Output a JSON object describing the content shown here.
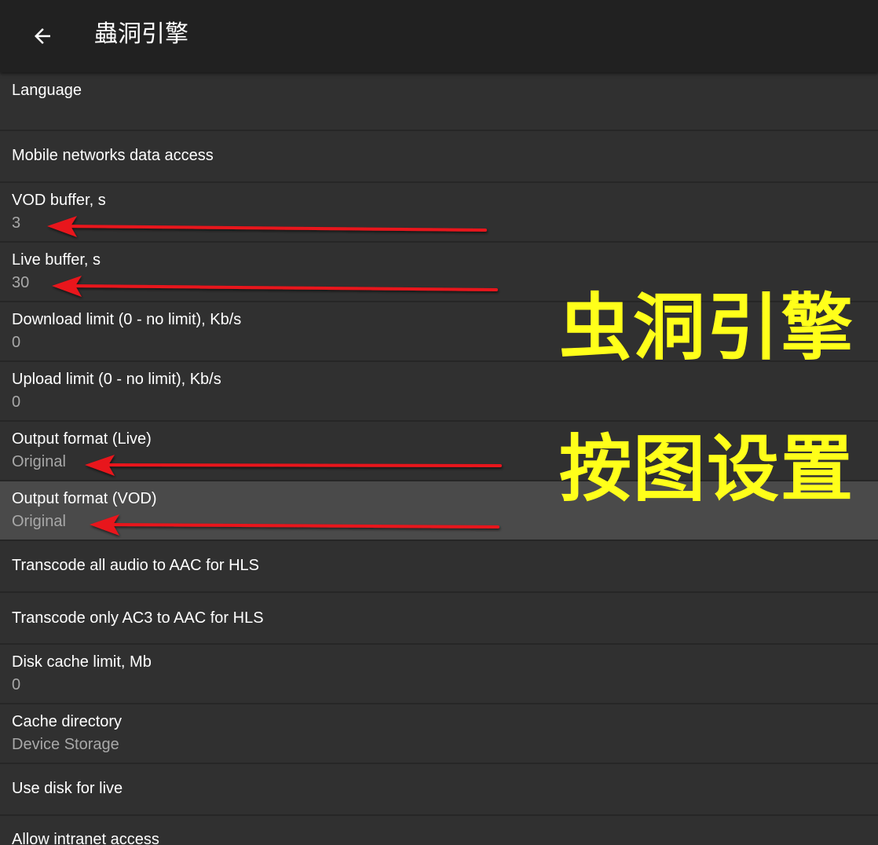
{
  "app_bar": {
    "title": "蟲洞引擎",
    "back_icon": "arrow-back-icon"
  },
  "settings": [
    {
      "id": "language",
      "title": "Language",
      "summary": ""
    },
    {
      "id": "mobile-data",
      "title": "Mobile networks data access",
      "summary": ""
    },
    {
      "id": "vod-buffer",
      "title": "VOD buffer, s",
      "summary": "3"
    },
    {
      "id": "live-buffer",
      "title": "Live buffer, s",
      "summary": "30"
    },
    {
      "id": "download-limit",
      "title": "Download limit (0 - no limit), Kb/s",
      "summary": "0"
    },
    {
      "id": "upload-limit",
      "title": "Upload limit (0 - no limit), Kb/s",
      "summary": "0"
    },
    {
      "id": "output-format-live",
      "title": "Output format (Live)",
      "summary": "Original"
    },
    {
      "id": "output-format-vod",
      "title": "Output format (VOD)",
      "summary": "Original"
    },
    {
      "id": "transcode-all-audio",
      "title": "Transcode all audio to AAC for HLS",
      "summary": ""
    },
    {
      "id": "transcode-ac3",
      "title": "Transcode only AC3 to AAC for HLS",
      "summary": ""
    },
    {
      "id": "disk-cache-limit",
      "title": "Disk cache limit, Mb",
      "summary": "0"
    },
    {
      "id": "cache-directory",
      "title": "Cache directory",
      "summary": "Device Storage"
    },
    {
      "id": "use-disk-live",
      "title": "Use disk for live",
      "summary": ""
    },
    {
      "id": "allow-intranet",
      "title": "Allow intranet access",
      "summary": ""
    }
  ],
  "overlay": {
    "line1": "虫洞引擎",
    "line2": "按图设置"
  },
  "colors": {
    "toolbar": "#212121",
    "background": "#303030",
    "selected_row": "#4a4a4a",
    "overlay_text": "#ffff1a",
    "arrow": "#e8141c"
  }
}
